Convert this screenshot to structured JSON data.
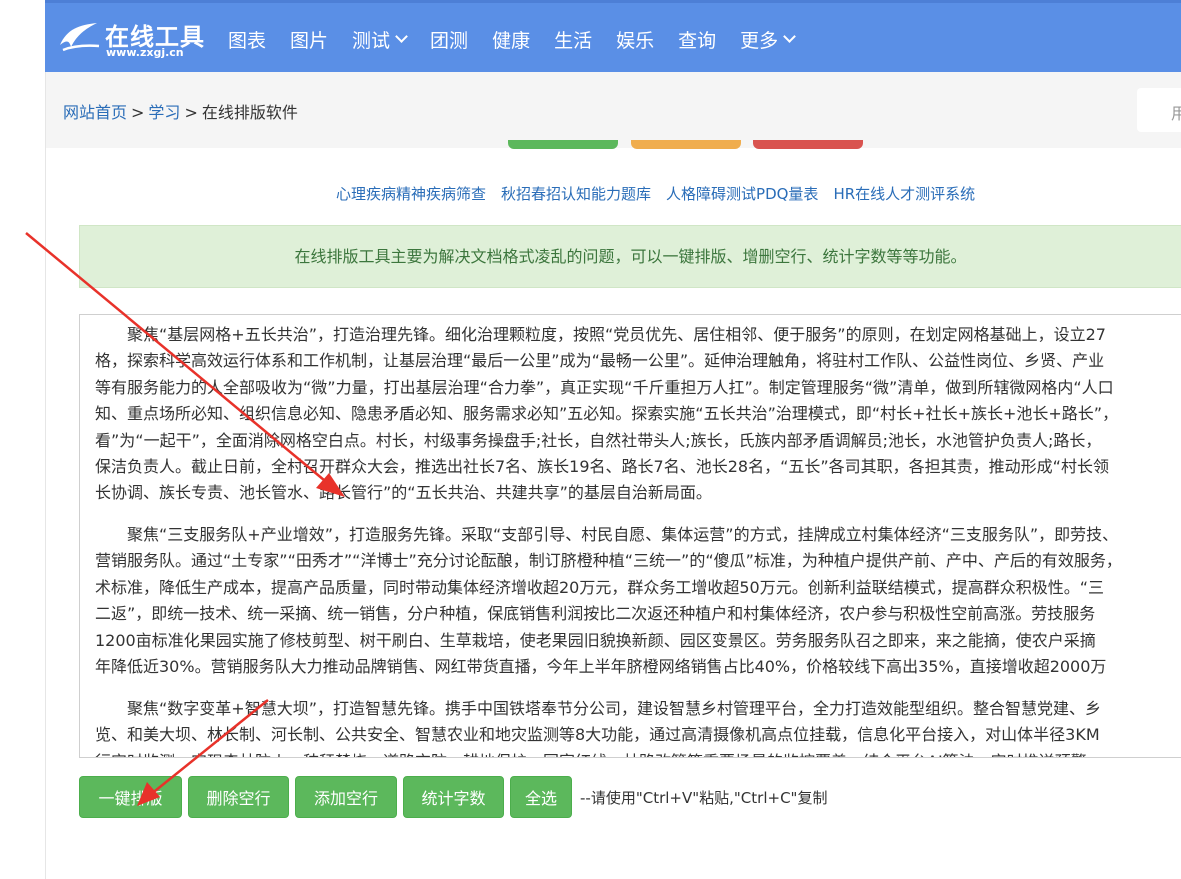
{
  "header": {
    "logo_title": "在线工具",
    "logo_url": "www.zxgj.cn",
    "nav": [
      {
        "label": "图表",
        "dropdown": false
      },
      {
        "label": "图片",
        "dropdown": false
      },
      {
        "label": "测试",
        "dropdown": true
      },
      {
        "label": "团测",
        "dropdown": false
      },
      {
        "label": "健康",
        "dropdown": false
      },
      {
        "label": "生活",
        "dropdown": false
      },
      {
        "label": "娱乐",
        "dropdown": false
      },
      {
        "label": "查询",
        "dropdown": false
      },
      {
        "label": "更多",
        "dropdown": true
      }
    ]
  },
  "breadcrumb": {
    "home": "网站首页",
    "section": "学习",
    "current": "在线排版软件",
    "separator": ">"
  },
  "search": {
    "placeholder": "用"
  },
  "tab_colors": [
    "#5cb85c",
    "#f0ad4e",
    "#d9534f"
  ],
  "related_links": [
    "心理疾病精神疾病筛查",
    "秋招春招认知能力题库",
    "人格障碍测试PDQ量表",
    "HR在线人才测评系统"
  ],
  "notice": "在线排版工具主要为解决文档格式凌乱的问题，可以一键排版、增删空行、统计字数等等功能。",
  "editor": {
    "paragraphs": [
      [
        "　　聚焦“基层网格+五长共治”，打造治理先锋。细化治理颗粒度，按照“党员优先、居住相邻、便于服务”的原则，在划定网格基础上，设立27",
        "格，探索科学高效运行体系和工作机制，让基层治理“最后一公里”成为“最畅一公里”。延伸治理触角，将驻村工作队、公益性岗位、乡贤、产业",
        "等有服务能力的人全部吸收为“微”力量，打出基层治理“合力拳”，真正实现“千斤重担万人扛”。制定管理服务“微”清单，做到所辖微网格内“人口",
        "知、重点场所必知、组织信息必知、隐患矛盾必知、服务需求必知”五必知。探索实施“五长共治”治理模式，即“村长+社长+族长+池长+路长”，",
        "看”为“一起干”，全面消除网格空白点。村长，村级事务操盘手;社长，自然社带头人;族长，氏族内部矛盾调解员;池长，水池管护负责人;路长，",
        "保洁负责人。截止日前，全村召开群众大会，推选出社长7名、族长19名、路长7名、池长28名，“五长”各司其职，各担其责，推动形成“村长领",
        "长协调、族长专责、池长管水、路长管行”的“五长共治、共建共享”的基层自治新局面。"
      ],
      [
        "　　聚焦“三支服务队+产业增效”，打造服务先锋。采取“支部引导、村民自愿、集体运营”的方式，挂牌成立村集体经济“三支服务队”，即劳技、",
        "营销服务队。通过“土专家”“田秀才”“洋博士”充分讨论酝酿，制订脐橙种植“三统一”的“傻瓜”标准，为种植户提供产前、产中、产后的有效服务，",
        "术标准，降低生产成本，提高产品质量，同时带动集体经济增收超20万元，群众务工增收超50万元。创新利益联结模式，提高群众积极性。“三",
        "二返”，即统一技术、统一采摘、统一销售，分户种植，保底销售利润按比二次返还种植户和村集体经济，农户参与积极性空前高涨。劳技服务",
        "1200亩标准化果园实施了修枝剪型、树干刷白、生草栽培，使老果园旧貌换新颜、园区变景区。劳务服务队召之即来，来之能摘，使农户采摘",
        "年降低近30%。营销服务队大力推动品牌销售、网红带货直播，今年上半年脐橙网络销售占比40%，价格较线下高出35%，直接增收超2000万"
      ],
      [
        "　　聚焦“数字变革+智慧大坝”，打造智慧先锋。携手中国铁塔奉节分公司，建设智慧乡村管理平台，全力打造效能型组织。整合智慧党建、乡",
        "览、和美大坝、林长制、河长制、公共安全、智慧农业和地灾监测等8大功能，通过高清摄像机高点位挂载，信息化平台接入，对山体半径3KM",
        "行实时监测，实现森林防火、秸秆禁烧、道路交防、耕地保护、国家红线、林路改管等重要场景的监控覆盖，结合平台AI算法，实时推送预警"
      ]
    ]
  },
  "buttons": [
    "一键排版",
    "删除空行",
    "添加空行",
    "统计字数",
    "全选"
  ],
  "hint": "--请使用\"Ctrl+V\"粘贴,\"Ctrl+C\"复制",
  "annotation_color": "#e8322a"
}
